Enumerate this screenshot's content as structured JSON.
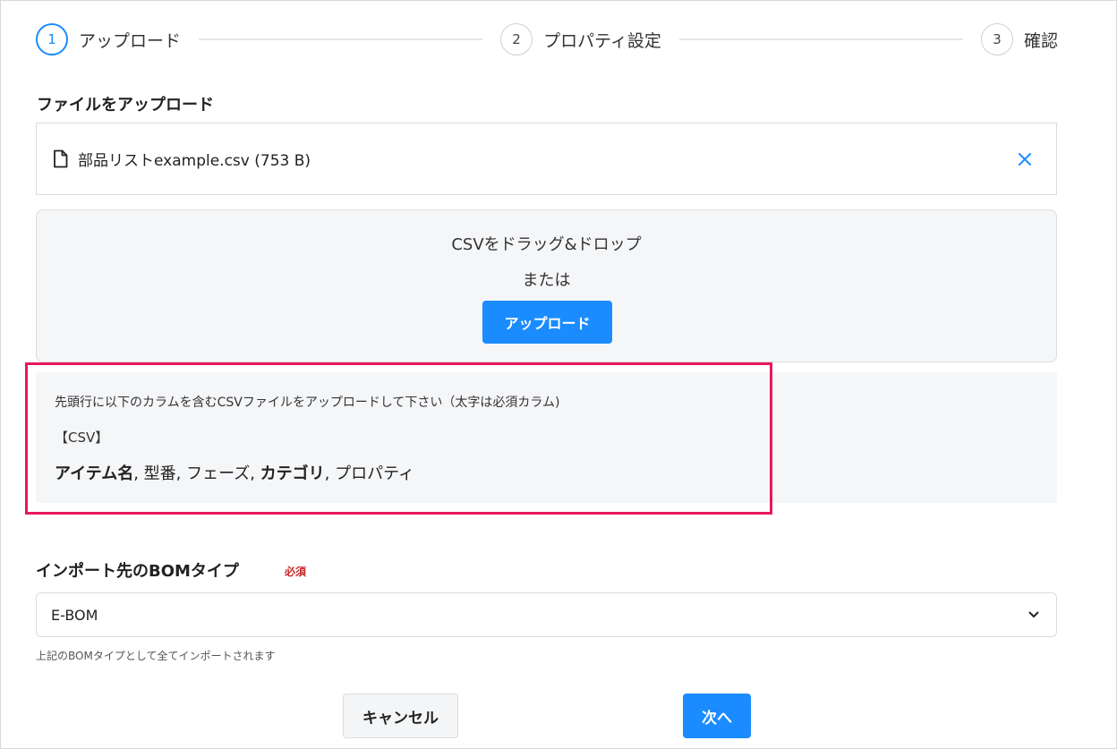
{
  "stepper": {
    "steps": [
      {
        "number": "1",
        "label": "アップロード",
        "active": true
      },
      {
        "number": "2",
        "label": "プロパティ設定",
        "active": false
      },
      {
        "number": "3",
        "label": "確認",
        "active": false
      }
    ]
  },
  "upload_section": {
    "title": "ファイルをアップロード",
    "file": {
      "name": "部品リストexample.csv (753 B)",
      "icon": "file-icon",
      "remove_icon": "close-icon"
    },
    "dropzone": {
      "text": "CSVをドラッグ&ドロップ",
      "or_text": "または",
      "button_label": "アップロード"
    }
  },
  "info": {
    "line1": "先頭行に以下のカラムを含むCSVファイルをアップロードして下さい（太字は必須カラム)",
    "line2": "【CSV】",
    "columns": [
      {
        "text": "アイテム名",
        "bold": true
      },
      {
        "text": ", 型番, フェーズ, ",
        "bold": false
      },
      {
        "text": "カテゴリ",
        "bold": true
      },
      {
        "text": ", プロパティ",
        "bold": false
      }
    ]
  },
  "bom": {
    "label": "インポート先のBOMタイプ",
    "required_label": "必須",
    "selected_value": "E-BOM",
    "hint": "上記のBOMタイプとして全てインポートされます"
  },
  "actions": {
    "cancel_label": "キャンセル",
    "next_label": "次へ"
  },
  "colors": {
    "accent": "#1a8cff",
    "highlight_border": "#e8175d",
    "required": "#c62828",
    "panel_bg": "#f5f6f8"
  }
}
